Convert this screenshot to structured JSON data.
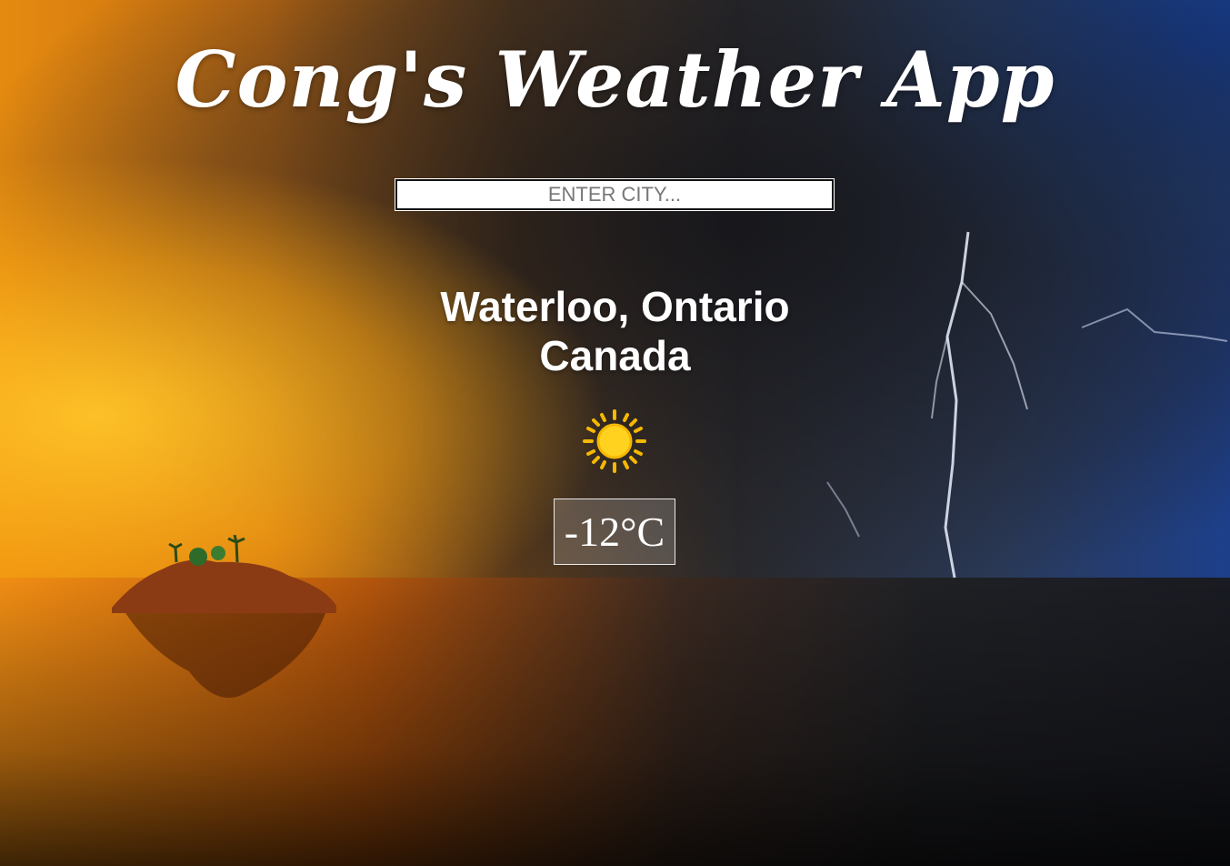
{
  "app": {
    "title": "Cong's Weather App"
  },
  "search": {
    "placeholder": "ENTER CITY..."
  },
  "location": {
    "line1": "Waterloo, Ontario",
    "line2": "Canada"
  },
  "weather": {
    "icon": "sun-icon",
    "temperature": "-12°C"
  },
  "colors": {
    "text": "#ffffff",
    "sun": "#f5b800",
    "sun_core": "#ffd21f"
  }
}
